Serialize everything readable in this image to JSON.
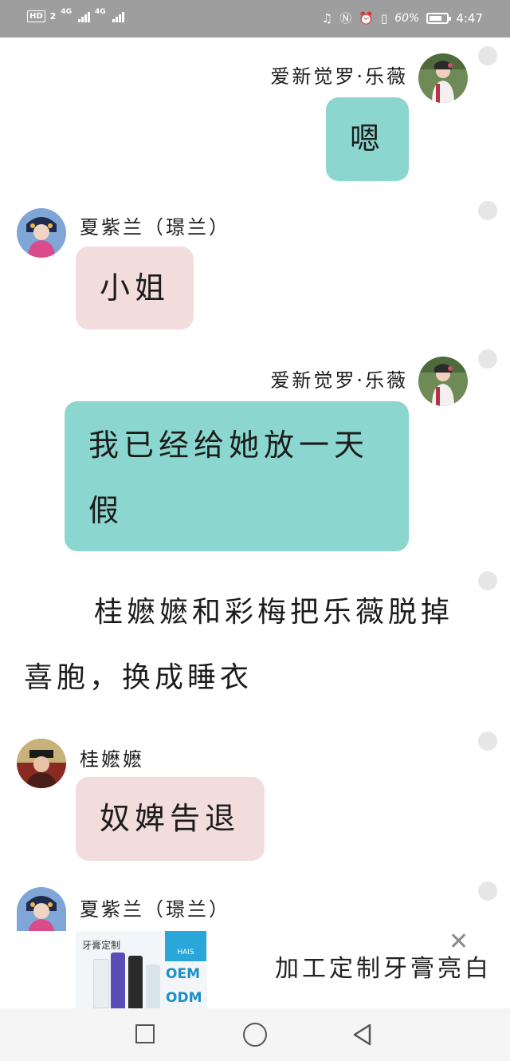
{
  "status_bar": {
    "hd_label": "HD",
    "sim1": "2",
    "network1": "4G",
    "network2": "4G",
    "battery_percent": "60%",
    "battery_level": 0.6,
    "time": "4:47"
  },
  "messages": [
    {
      "sender": "爱新觉罗·乐薇",
      "text": "嗯"
    },
    {
      "sender": "夏紫兰（璟兰）",
      "text": "小姐"
    },
    {
      "sender": "爱新觉罗·乐薇",
      "text": "我已经给她放一天假"
    },
    {
      "narration": "桂嬷嬷和彩梅把乐薇脱掉喜胞，换成睡衣"
    },
    {
      "sender": "桂嬷嬷",
      "text": "奴婢告退"
    },
    {
      "sender": "夏紫兰（璟兰）"
    }
  ],
  "ad": {
    "image_tag": "牙膏定制",
    "brand": "HAIS",
    "oem": "OEM",
    "odm": "ODM",
    "headline": "加工定制牙膏亮白",
    "close_icon": "close-icon"
  },
  "nav": {
    "recent_icon": "square-recents-icon",
    "home_icon": "circle-home-icon",
    "back_icon": "triangle-back-icon"
  }
}
